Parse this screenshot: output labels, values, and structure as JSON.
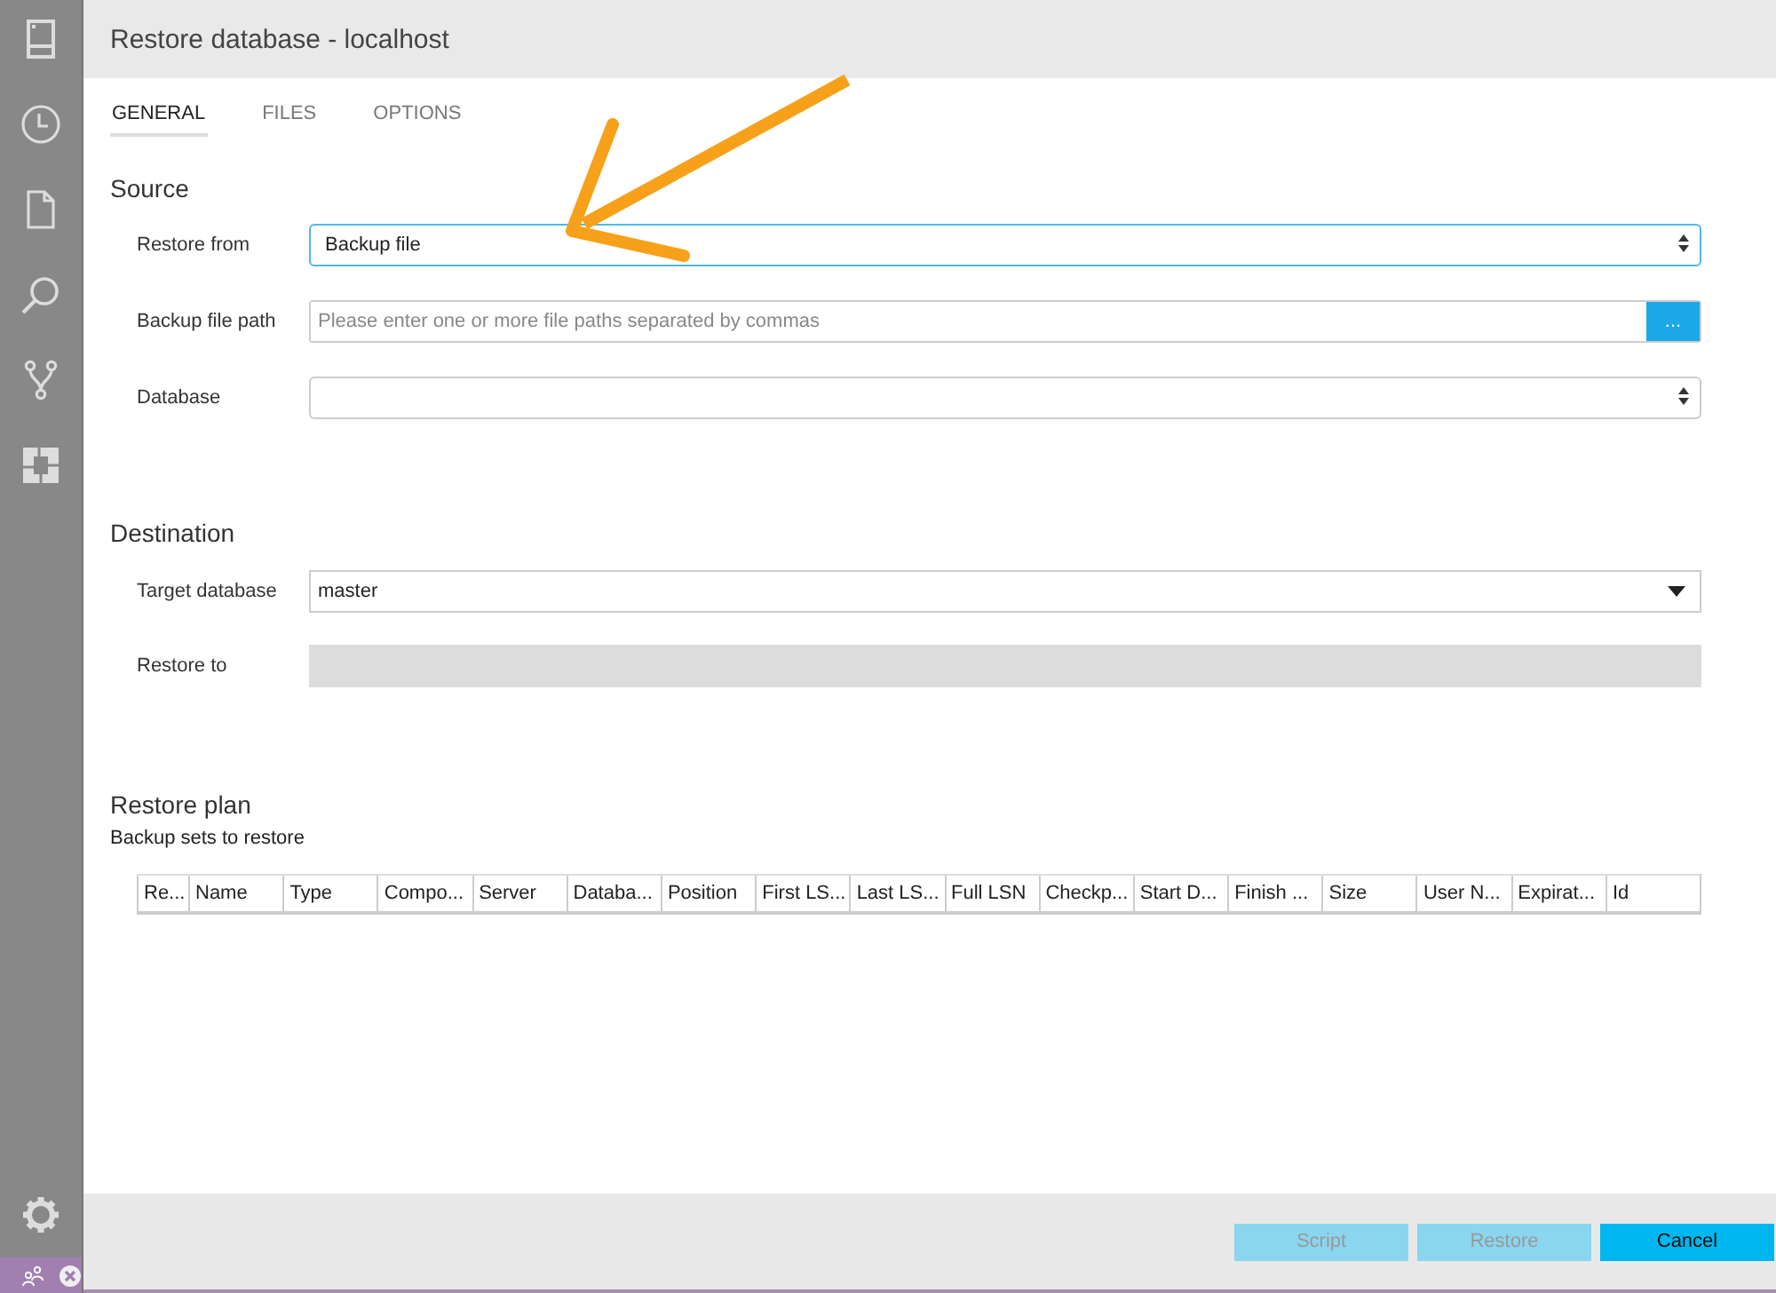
{
  "window": {
    "title": "Restore database - localhost"
  },
  "tabs": [
    {
      "label": "GENERAL",
      "selected": true
    },
    {
      "label": "FILES",
      "selected": false
    },
    {
      "label": "OPTIONS",
      "selected": false
    }
  ],
  "sections": [
    {
      "title": "Source",
      "fields": [
        {
          "label": "Restore from",
          "kind": "select",
          "value": "Backup file",
          "focused": true
        },
        {
          "label": "Backup file path",
          "kind": "path",
          "placeholder": "Please enter one or more file paths separated by commas",
          "button": "...",
          "focused": false
        },
        {
          "label": "Database",
          "kind": "select",
          "focused": false
        }
      ]
    },
    {
      "title": "Destination",
      "fields": [
        {
          "label": "Target database",
          "kind": "dropdown",
          "value": "master",
          "focused": false
        },
        {
          "label": "Restore to",
          "kind": "disabled",
          "focused": false
        }
      ]
    }
  ],
  "restore_plan": {
    "title": "Restore plan",
    "subtitle": "Backup sets to restore",
    "columns": [
      "Re...",
      "Name",
      "Type",
      "Compo...",
      "Server",
      "Databa...",
      "Position",
      "First LS...",
      "Last LS...",
      "Full LSN",
      "Checkp...",
      "Start D...",
      "Finish ...",
      "Size",
      "User N...",
      "Expirat...",
      "Id"
    ]
  },
  "buttons": [
    {
      "label": "Script",
      "disabled": true
    },
    {
      "label": "Restore",
      "disabled": true
    },
    {
      "label": "Cancel",
      "disabled": false
    }
  ],
  "annotation": {
    "kind": "arrow"
  }
}
